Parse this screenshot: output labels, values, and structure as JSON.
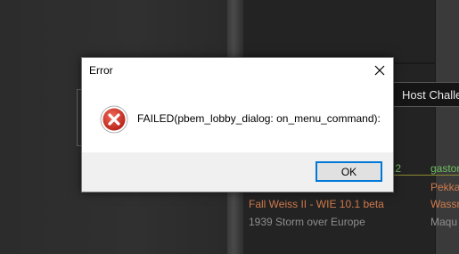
{
  "dialog": {
    "title": "Error",
    "message": "FAILED(pbem_lobby_dialog: on_menu_command):",
    "ok_label": "OK",
    "close_glyph": "×",
    "icon": "error-icon",
    "accent_color": "#0078d7",
    "icon_color": "#c42b1c"
  },
  "background": {
    "host_button_label": "Host Challe",
    "rows": [
      {
        "version": ".2",
        "player": "gastor"
      },
      {
        "player": "Pekka"
      },
      {
        "title": "Fall Weiss II - WIE 10.1 beta",
        "player": "Wassm"
      },
      {
        "title": "1939 Storm over Europe",
        "player": "Maqu"
      }
    ]
  }
}
